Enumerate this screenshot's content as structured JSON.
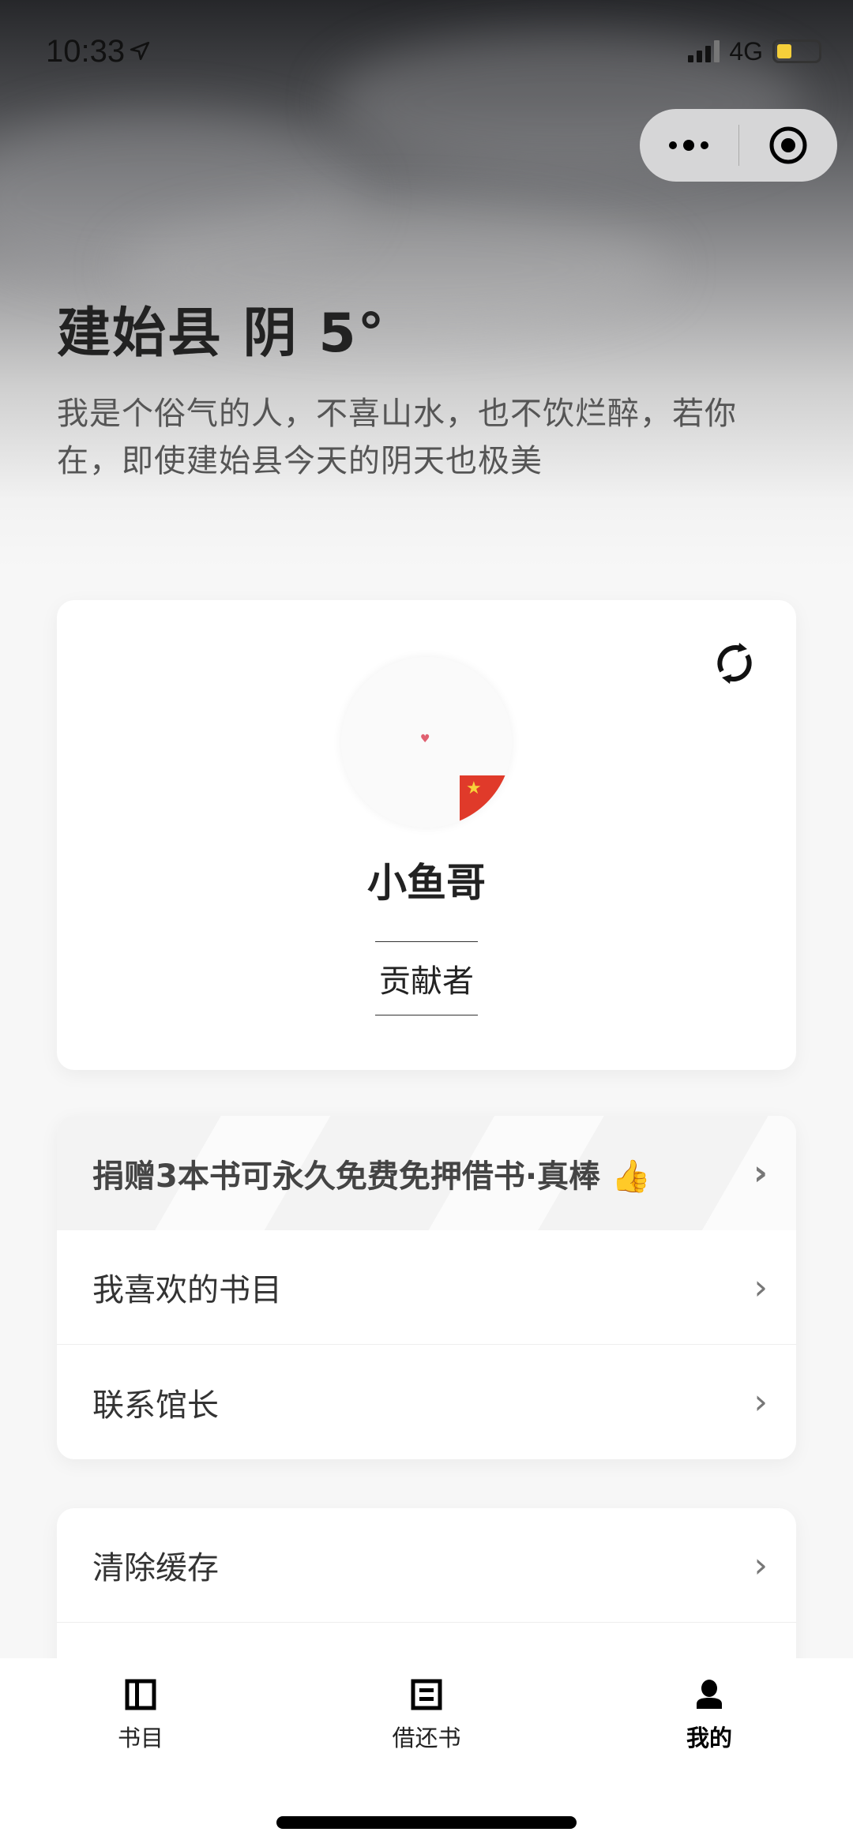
{
  "status_bar": {
    "time": "10:33",
    "network": "4G",
    "battery_color": "#f5cf3a"
  },
  "capsule": {
    "more_icon": "more-dots-icon",
    "close_icon": "target-circle-icon"
  },
  "weather": {
    "title": "建始县 阴 5°",
    "quote": "我是个俗气的人，不喜山水，也不饮烂醉，若你在，即使建始县今天的阴天也极美"
  },
  "profile": {
    "name": "小鱼哥",
    "role": "贡献者"
  },
  "menu": {
    "items": [
      {
        "label": "捐赠3本书可永久免费免押借书·真棒 👍"
      },
      {
        "label": "我喜欢的书目"
      },
      {
        "label": "联系馆长"
      }
    ]
  },
  "settings": {
    "items": [
      {
        "label": "清除缓存"
      },
      {
        "label": ""
      }
    ]
  },
  "tabbar": {
    "items": [
      {
        "label": "书目"
      },
      {
        "label": "借还书"
      },
      {
        "label": "我的"
      }
    ],
    "active": "我的"
  },
  "chevron": "›"
}
